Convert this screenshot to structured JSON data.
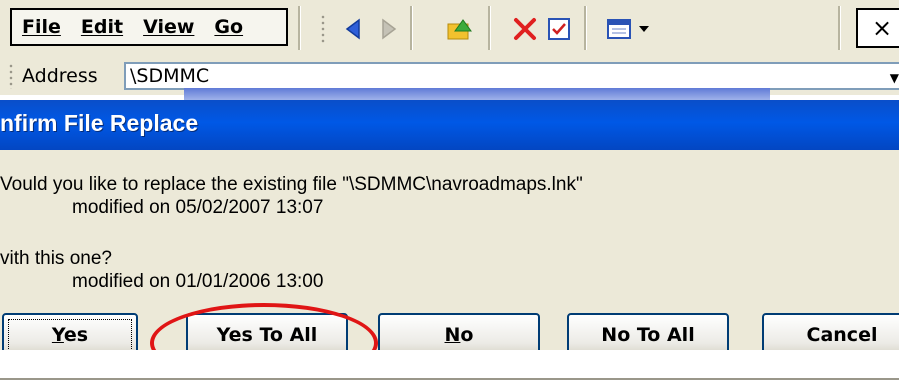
{
  "menubar": {
    "items": [
      "File",
      "Edit",
      "View",
      "Go"
    ]
  },
  "toolbar": {
    "icons": [
      "back-arrow-icon",
      "forward-arrow-icon",
      "up-folder-icon",
      "delete-icon",
      "properties-icon",
      "views-icon"
    ],
    "close_label": "×"
  },
  "address": {
    "label": "Address",
    "value": "\\SDMMC"
  },
  "dialog": {
    "title": "nfirm File Replace",
    "line1": "Vould you like to replace the existing file \"\\SDMMC\\navroadmaps.lnk\"",
    "line2": "modified on 05/02/2007 13:07",
    "line3": "vith this one?",
    "line4": "modified on 01/01/2006 13:00",
    "buttons": {
      "yes": "Yes",
      "yes_to_all": "Yes To All",
      "no": "No",
      "no_to_all": "No To All",
      "cancel": "Cancel"
    }
  },
  "colors": {
    "titlebar": "#0058e6",
    "highlight": "#e01515",
    "chrome": "#ece9d8"
  }
}
